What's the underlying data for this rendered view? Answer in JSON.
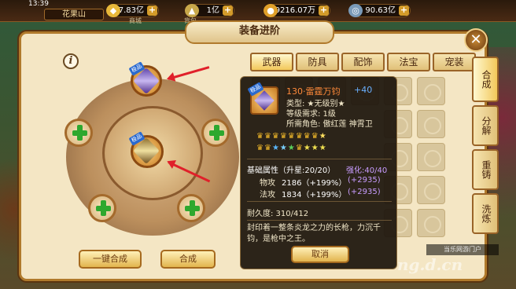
{
  "status": {
    "time": "13:39",
    "location": "花果山"
  },
  "currencies": [
    {
      "name": "ingot",
      "value": "57.83亿",
      "icon": "gold-ingot-icon",
      "sub": "商城"
    },
    {
      "name": "silver",
      "value": "1亿",
      "icon": "silver-icon",
      "sub": "背包"
    },
    {
      "name": "coin",
      "value": "9216.07万",
      "icon": "copper-coin-icon",
      "sub": ""
    },
    {
      "name": "points",
      "value": "90.63亿",
      "icon": "points-icon",
      "sub": ""
    }
  ],
  "panel": {
    "title": "装备进阶"
  },
  "tabs": [
    "武器",
    "防具",
    "配饰",
    "法宝",
    "宠装"
  ],
  "side_tabs": [
    "合成",
    "分解",
    "重铸",
    "洗炼"
  ],
  "slot_tag": "极品",
  "buttons": {
    "one_click": "一键合成",
    "compose": "合成",
    "cancel": "取消"
  },
  "tooltip": {
    "name": "130·雷霆万钧",
    "plus": "+40",
    "type": "类型: ★无级别★",
    "level_req": "等级需求: 1级",
    "role": "所需角色: 傲红莲 神霄卫",
    "base_label": "基础属性（升星:20/20）",
    "enhance_label": "强化:40/40",
    "phys_label": "物攻",
    "phys_value": "2186（+199%）",
    "phys_bonus": "(+2935)",
    "mag_label": "法攻",
    "mag_value": "1834（+199%）",
    "mag_bonus": "(+2935)",
    "durability": "耐久度: 310/412",
    "desc": "封印着一整条炎龙之力的长枪，力沉千钧，是枪中之王。"
  },
  "watermark": {
    "line1": "当乐网游门户",
    "line2": "ng.d.cn"
  },
  "colors": {
    "panel_bg": "#f4e6c4",
    "border": "#b07a2c",
    "plus_green": "#2ea82e",
    "arrow_red": "#e0202a",
    "name_orange": "#ff8a3a",
    "plus_blue": "#6ab0ff",
    "enhance_purple": "#c89cff"
  }
}
